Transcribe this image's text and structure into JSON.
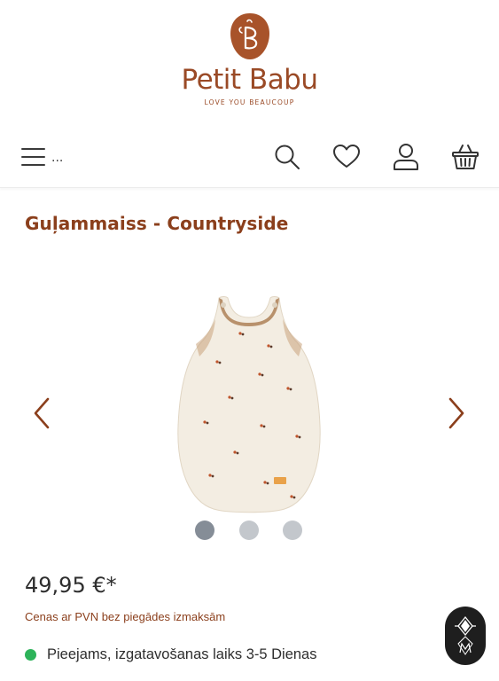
{
  "brand": {
    "name": "Petit Babu",
    "tagline": "LOVE YOU BEAUCOUP",
    "accent_color": "#9a4a26"
  },
  "header": {
    "menu_more": "...",
    "icons": [
      "menu-icon",
      "search-icon",
      "heart-icon",
      "user-icon",
      "basket-icon"
    ]
  },
  "product": {
    "title": "Guļammaiss - Countryside",
    "price": "49,95 €*",
    "vat_note": "Cenas ar PVN bez piegādes izmaksām",
    "availability": "Pieejams, izgatavošanas laiks 3-5 Dienas",
    "availability_color": "#2db35a",
    "gallery": {
      "image_count": 3,
      "active_index": 0,
      "prev_icon": "chevron-left-icon",
      "next_icon": "chevron-right-icon"
    }
  }
}
